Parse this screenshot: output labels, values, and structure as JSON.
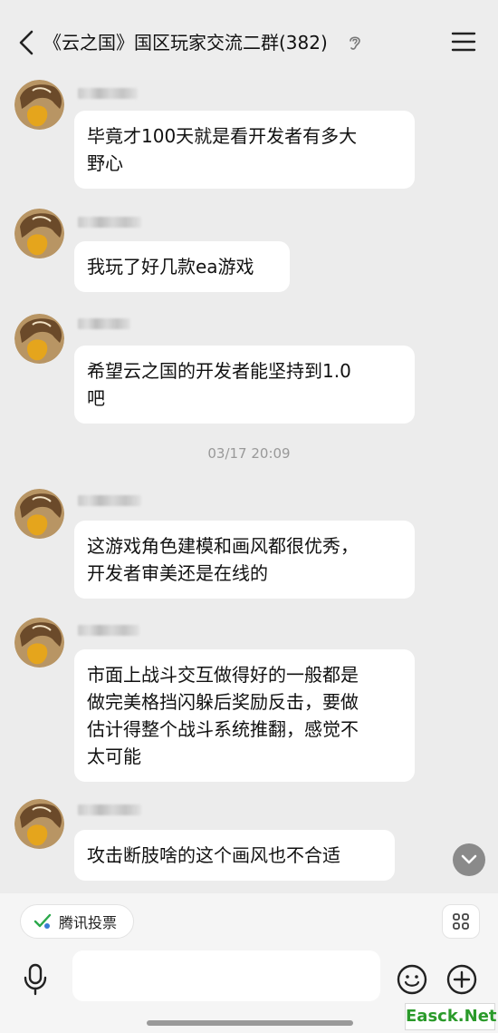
{
  "header": {
    "title": "《云之国》国区玩家交流二群(382)",
    "back_icon": "chevron-left-icon",
    "ear_icon": "ear-icon",
    "menu_icon": "hamburger-menu-icon"
  },
  "messages": [
    {
      "sender": "",
      "text_lines": [
        "毕竟才100天就是看开发者有多大",
        "野心"
      ]
    },
    {
      "sender": "",
      "text_lines": [
        "我玩了好几款ea游戏"
      ]
    },
    {
      "sender": "",
      "text_lines": [
        "希望云之国的开发者能坚持到1.0",
        "吧"
      ]
    },
    {
      "sender": "",
      "text_lines": [
        "这游戏角色建模和画风都很优秀，",
        "开发者审美还是在线的"
      ]
    },
    {
      "sender": "",
      "text_lines": [
        "市面上战斗交互做得好的一般都是",
        "做完美格挡闪躲后奖励反击，要做",
        "估计得整个战斗系统推翻，感觉不",
        "太可能"
      ]
    },
    {
      "sender": "",
      "text_lines": [
        "攻击断肢啥的这个画风也不合适"
      ]
    }
  ],
  "timestamp": "03/17 20:09",
  "toolbar": {
    "vote_label": "腾讯投票",
    "vote_icon": "vote-check-icon",
    "apps_icon": "apps-grid-icon",
    "mic_icon": "microphone-icon",
    "emoji_icon": "smiley-icon",
    "plus_icon": "plus-circle-icon",
    "input_placeholder": ""
  },
  "scroll_icon": "chevron-down-icon",
  "watermark": "Easck.Net",
  "colors": {
    "background": "#ececec",
    "bubble": "#ffffff",
    "watermark_green": "#2a9a2a"
  }
}
